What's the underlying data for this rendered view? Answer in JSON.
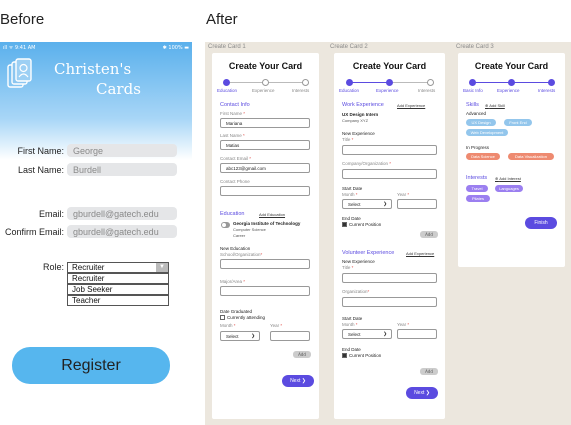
{
  "labels": {
    "before": "Before",
    "after": "After"
  },
  "phone": {
    "status_left": "ıll ᯤ 9:41 AM",
    "status_right": "✱ 100% ▬",
    "app_title_line1": "Christen's",
    "app_title_line2": "Cards",
    "fields": [
      {
        "label": "First Name:",
        "value": "George"
      },
      {
        "label": "Last Name:",
        "value": "Burdell"
      },
      {
        "label": "Email:",
        "value": "gburdell@gatech.edu"
      },
      {
        "label": "Confirm Email:",
        "value": "gburdell@gatech.edu"
      }
    ],
    "role_label": "Role:",
    "role_selected": "Recruiter",
    "role_options": [
      "Recruiter",
      "Job Seeker",
      "Teacher"
    ],
    "register_label": "Register"
  },
  "card1": {
    "frame": "Create Card 1",
    "title": "Create Your Card",
    "steps": [
      "Education",
      "Experience",
      "Interests"
    ],
    "contact_heading": "Contact Info",
    "first_name_label": "First Name",
    "first_name": "Mariana",
    "last_name_label": "Last Name",
    "last_name": "Matias",
    "email_label": "Contact Email",
    "email": "abc123@gmail.com",
    "phone_label": "Contact Phone",
    "education_heading": "Education",
    "add_education": "Add Education",
    "school_name": "Georgia Institute of Technology",
    "school_major": "Computer Science",
    "school_extra": "Career",
    "new_edu_label": "New Education",
    "school_org_label": "School/Organization",
    "major_label": "Major/Area",
    "date_grad_label": "Date Graduated",
    "currently_attending": "Currently attending",
    "month_label": "Month",
    "year_label": "Year",
    "select": "Select",
    "add": "Add",
    "next": "Next"
  },
  "card2": {
    "frame": "Create Card 2",
    "title": "Create Your Card",
    "steps": [
      "Education",
      "Experience",
      "Interests"
    ],
    "work_heading": "Work Experience",
    "add_work": "Add Experience",
    "job_title": "UX Design Intern",
    "job_company": "Company XYZ",
    "new_exp": "New Experience",
    "title_label": "Title",
    "company_label": "Company/Organization",
    "start_date": "Start Date",
    "month_label": "Month",
    "year_label": "Year",
    "select": "Select",
    "end_date": "End Date",
    "current_position": "Current Position",
    "add": "Add",
    "vol_heading": "Volunteer Experience",
    "add_vol": "Add Experience",
    "new_exp2": "New Experience",
    "title2_label": "Title",
    "org_label": "Organization",
    "start_date2": "Start Date",
    "month2_label": "Month",
    "year2_label": "Year",
    "select2": "Select",
    "end_date2": "End Date",
    "current_position2": "Current Position",
    "add2": "Add",
    "next": "Next"
  },
  "card3": {
    "frame": "Create Card 3",
    "title": "Create Your Card",
    "steps": [
      "Basic Info",
      "Experience",
      "Interests"
    ],
    "skills_heading": "Skills",
    "add_skill": "Add Skill",
    "advanced": "Advanced",
    "advanced_pills": [
      {
        "label": "UX Design",
        "color": "#93c6ec"
      },
      {
        "label": "Front End",
        "color": "#93c6ec"
      },
      {
        "label": "Web Development",
        "color": "#93c6ec"
      }
    ],
    "in_progress": "In Progress",
    "progress_pills": [
      {
        "label": "Data Science",
        "color": "#ee8a70"
      },
      {
        "label": "Data Visualization",
        "color": "#ee8a70"
      }
    ],
    "interests_heading": "Interests",
    "add_interest": "Add Interest",
    "interest_pills": [
      {
        "label": "Travel",
        "color": "#9b7ff0"
      },
      {
        "label": "Languages",
        "color": "#9b7ff0"
      },
      {
        "label": "Pilates",
        "color": "#9b7ff0"
      }
    ],
    "finish": "Finish"
  },
  "colors": {
    "accent": "#5b4be0",
    "phone_blue": "#56b6ee",
    "board": "#ece7de"
  }
}
